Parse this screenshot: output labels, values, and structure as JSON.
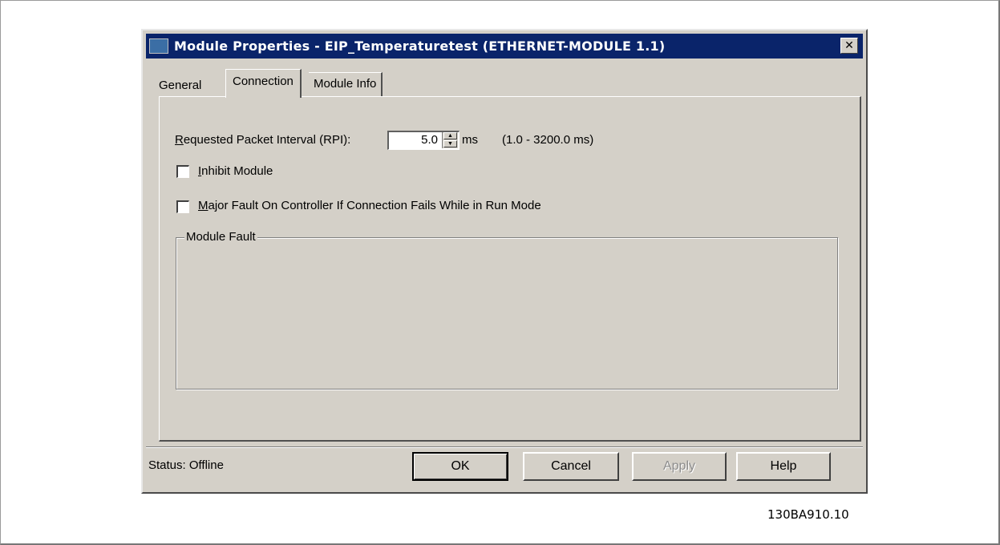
{
  "window": {
    "title": "Module Properties  - EIP_Temperaturetest (ETHERNET-MODULE 1.1)",
    "close_glyph": "✕"
  },
  "tabs": [
    {
      "label": "General",
      "active": false
    },
    {
      "label": "Connection",
      "active": true
    },
    {
      "label": "Module Info",
      "active": false
    }
  ],
  "connection": {
    "rpi": {
      "label_accel": "R",
      "label_rest": "equested Packet Interval (RPI):",
      "value": "5.0",
      "unit": "ms",
      "range": "(1.0 - 3200.0 ms)"
    },
    "inhibit_module": {
      "accel": "I",
      "rest": "nhibit Module",
      "checked": false
    },
    "major_fault": {
      "accel": "M",
      "rest": "ajor Fault On Controller If Connection Fails While in Run Mode",
      "checked": false
    },
    "module_fault_legend": "Module Fault"
  },
  "status": {
    "text": "Status:  Offline"
  },
  "buttons": {
    "ok": "OK",
    "cancel": "Cancel",
    "apply": "Apply",
    "help": "Help"
  },
  "figure_code": "130BA910.10"
}
